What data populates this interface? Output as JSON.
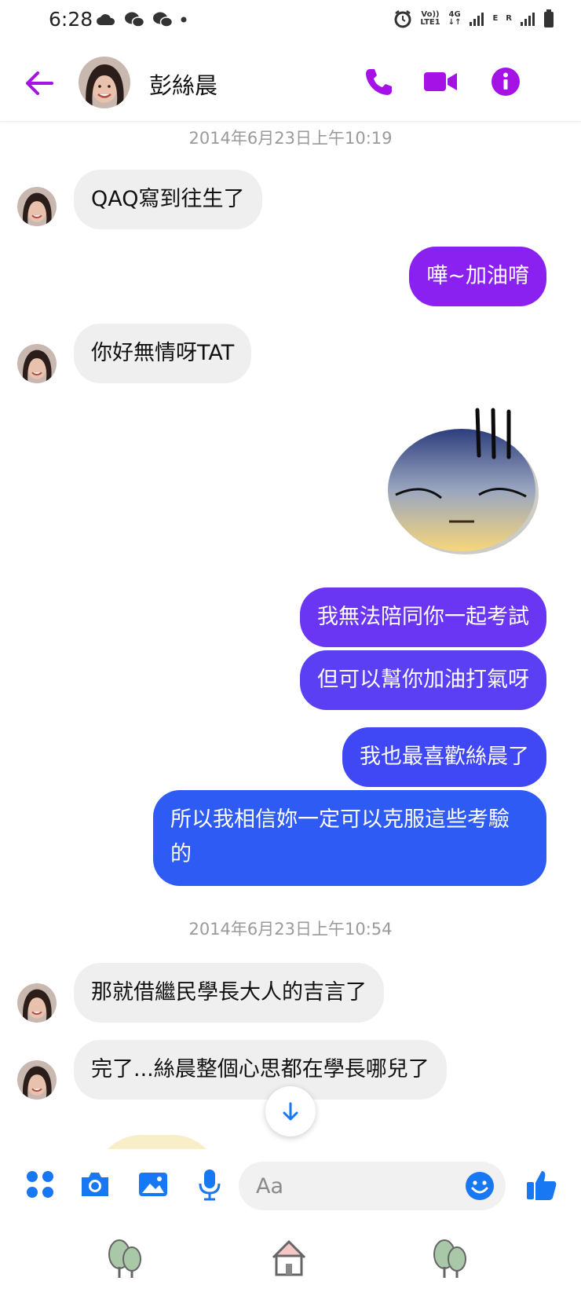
{
  "status_bar": {
    "time": "6:28",
    "net_top": "Vo))",
    "net_bottom": "LTE1",
    "net_4g": "4G",
    "e_label": "E",
    "r_label": "R"
  },
  "header": {
    "contact_name": "彭絲晨",
    "back_icon": "arrow-left",
    "call_icon": "phone",
    "video_icon": "video-camera",
    "info_icon": "info"
  },
  "messages": {
    "timestamp_1": "2014年6月23日上午10:19",
    "m1": "QAQ寫到往生了",
    "m2": "嘩~加油唷",
    "m3": "你好無情呀TAT",
    "m4": "我無法陪同你一起考試",
    "m5": "但可以幫你加油打氣呀",
    "m6": "我也最喜歡絲晨了",
    "m7": "所以我相信妳一定可以克服這些考驗的",
    "timestamp_2": "2014年6月23日上午10:54",
    "m8": "那就借繼民學長大人的吉言了",
    "m9": "完了...絲晨整個心思都在學長哪兒了"
  },
  "composer": {
    "placeholder": "Aa",
    "icons": [
      "menu-dots",
      "camera",
      "gallery",
      "microphone",
      "emoji",
      "thumbs-up"
    ]
  },
  "bottom_nav": {
    "icons": [
      "tree",
      "home",
      "tree"
    ]
  },
  "colors": {
    "accent_purple": "#a412e6",
    "bubble_purple": "#8a21f0",
    "bubble_indigo": "#5f38f2",
    "bubble_blue": "#3f4ff7",
    "bubble_blue_deep": "#2e5cf5",
    "received_gray": "#efefef",
    "composer_blue": "#1877f2"
  }
}
